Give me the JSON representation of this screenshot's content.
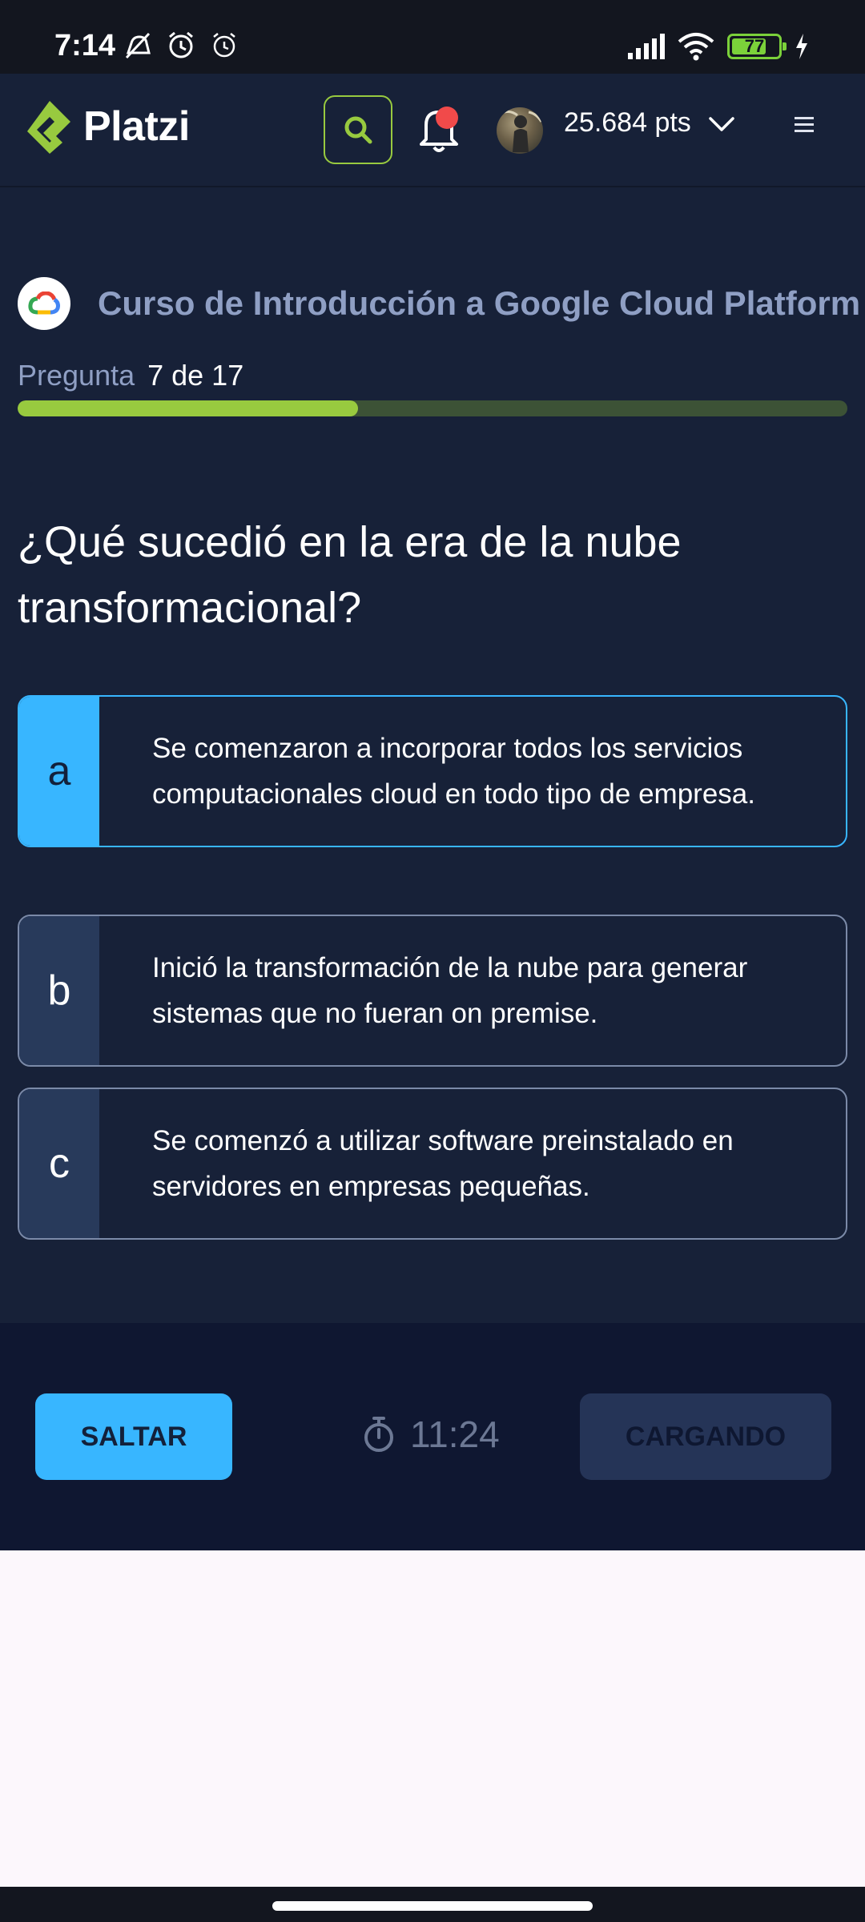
{
  "status_bar": {
    "time": "7:14",
    "battery": "77"
  },
  "header": {
    "logo_text": "Platzi",
    "points": "25.684 pts"
  },
  "course": {
    "title": "Curso de Introducción a Google Cloud Platform"
  },
  "progress": {
    "label": "Pregunta",
    "count": "7 de 17",
    "fraction": 0.41
  },
  "question": {
    "text": "¿Qué sucedió en la era de la nube transformacional?"
  },
  "answers": [
    {
      "letter": "a",
      "text": "Se comenzaron a incorporar todos los servicios computacionales cloud en todo tipo de empresa.",
      "selected": true
    },
    {
      "letter": "b",
      "text": "Inició la transformación de la nube para generar sistemas que no fueran on premise.",
      "selected": false
    },
    {
      "letter": "c",
      "text": "Se comenzó a utilizar software preinstalado en servidores en empresas pequeñas.",
      "selected": false
    }
  ],
  "footer": {
    "skip_label": "SALTAR",
    "timer": "11:24",
    "loading_label": "CARGANDO"
  },
  "colors": {
    "accent_green": "#98ca3f",
    "accent_blue": "#38b6ff",
    "background": "#172138",
    "notification": "#f14a4a"
  },
  "icons": [
    "do-not-disturb-icon",
    "alarm-icon",
    "signal-icon",
    "wifi-icon",
    "battery-icon",
    "charging-icon",
    "platzi-logo-icon",
    "search-icon",
    "bell-icon",
    "avatar",
    "chevron-down-icon",
    "menu-icon",
    "google-cloud-icon",
    "stopwatch-icon"
  ]
}
